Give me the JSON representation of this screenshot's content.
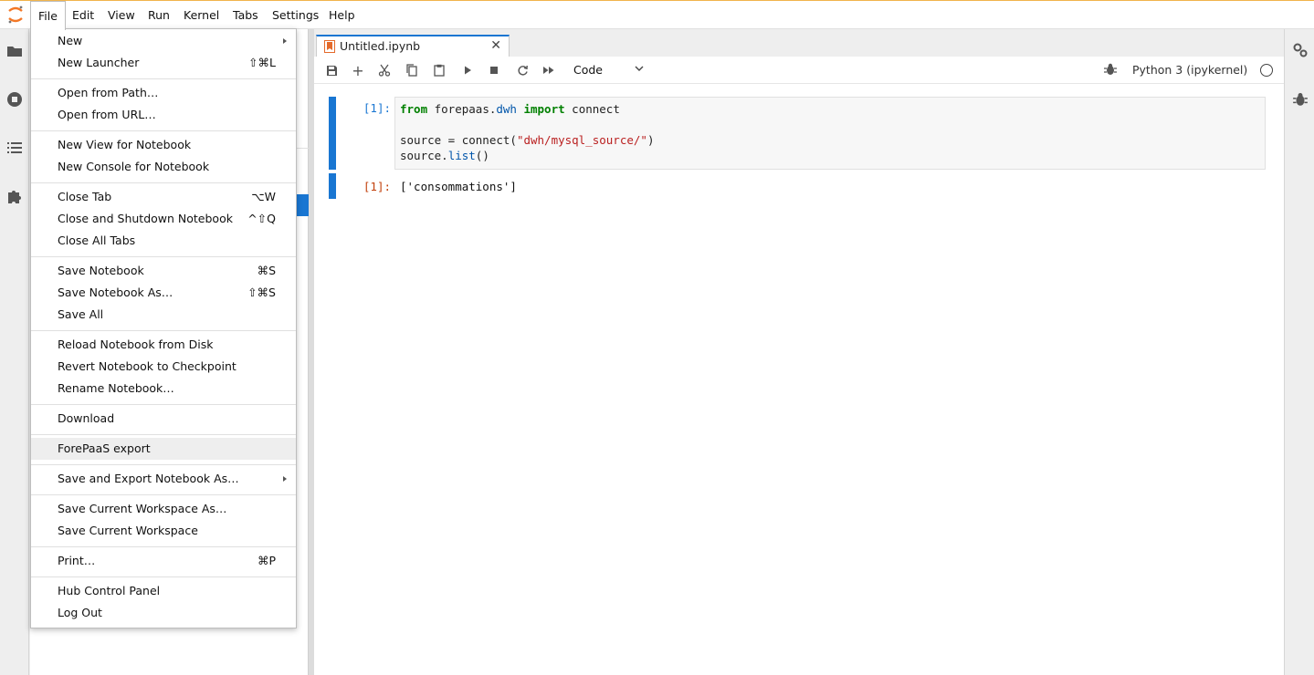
{
  "menubar": {
    "items": [
      "File",
      "Edit",
      "View",
      "Run",
      "Kernel",
      "Tabs",
      "Settings",
      "Help"
    ]
  },
  "file_menu": {
    "items": [
      {
        "label": "New",
        "shortcut": "",
        "submenu": true
      },
      {
        "label": "New Launcher",
        "shortcut": "⇧⌘L"
      },
      {
        "label": "Open from Path…",
        "shortcut": ""
      },
      {
        "label": "Open from URL…",
        "shortcut": ""
      },
      {
        "label": "New View for Notebook",
        "shortcut": ""
      },
      {
        "label": "New Console for Notebook",
        "shortcut": ""
      },
      {
        "label": "Close Tab",
        "shortcut": "⌥W"
      },
      {
        "label": "Close and Shutdown Notebook",
        "shortcut": "^⇧Q"
      },
      {
        "label": "Close All Tabs",
        "shortcut": ""
      },
      {
        "label": "Save Notebook",
        "shortcut": "⌘S"
      },
      {
        "label": "Save Notebook As…",
        "shortcut": "⇧⌘S"
      },
      {
        "label": "Save All",
        "shortcut": ""
      },
      {
        "label": "Reload Notebook from Disk",
        "shortcut": ""
      },
      {
        "label": "Revert Notebook to Checkpoint",
        "shortcut": ""
      },
      {
        "label": "Rename Notebook…",
        "shortcut": ""
      },
      {
        "label": "Download",
        "shortcut": ""
      },
      {
        "label": "ForePaaS export",
        "shortcut": "",
        "hovered": true
      },
      {
        "label": "Save and Export Notebook As…",
        "shortcut": "",
        "submenu": true
      },
      {
        "label": "Save Current Workspace As…",
        "shortcut": ""
      },
      {
        "label": "Save Current Workspace",
        "shortcut": ""
      },
      {
        "label": "Print…",
        "shortcut": "⌘P"
      },
      {
        "label": "Hub Control Panel",
        "shortcut": ""
      },
      {
        "label": "Log Out",
        "shortcut": ""
      }
    ]
  },
  "notebook": {
    "tab_title": "Untitled.ipynb",
    "cell_type": "Code",
    "kernel_name": "Python 3 (ipykernel)",
    "input_prompt": "[1]:",
    "output_prompt": "[1]:",
    "code": {
      "l1_kw1": "from",
      "l1_mod": " forepaas",
      "l1_dot": ".",
      "l1_sub": "dwh",
      "l1_kw2": " import",
      "l1_rest": " connect",
      "l3_a": "source = connect(",
      "l3_str": "\"dwh/mysql_source/\"",
      "l3_b": ")",
      "l4_a": "source.",
      "l4_fn": "list",
      "l4_b": "()"
    },
    "output": "['consommations']"
  },
  "colors": {
    "accent": "#1976d2",
    "top_border": "#f1b44c"
  }
}
